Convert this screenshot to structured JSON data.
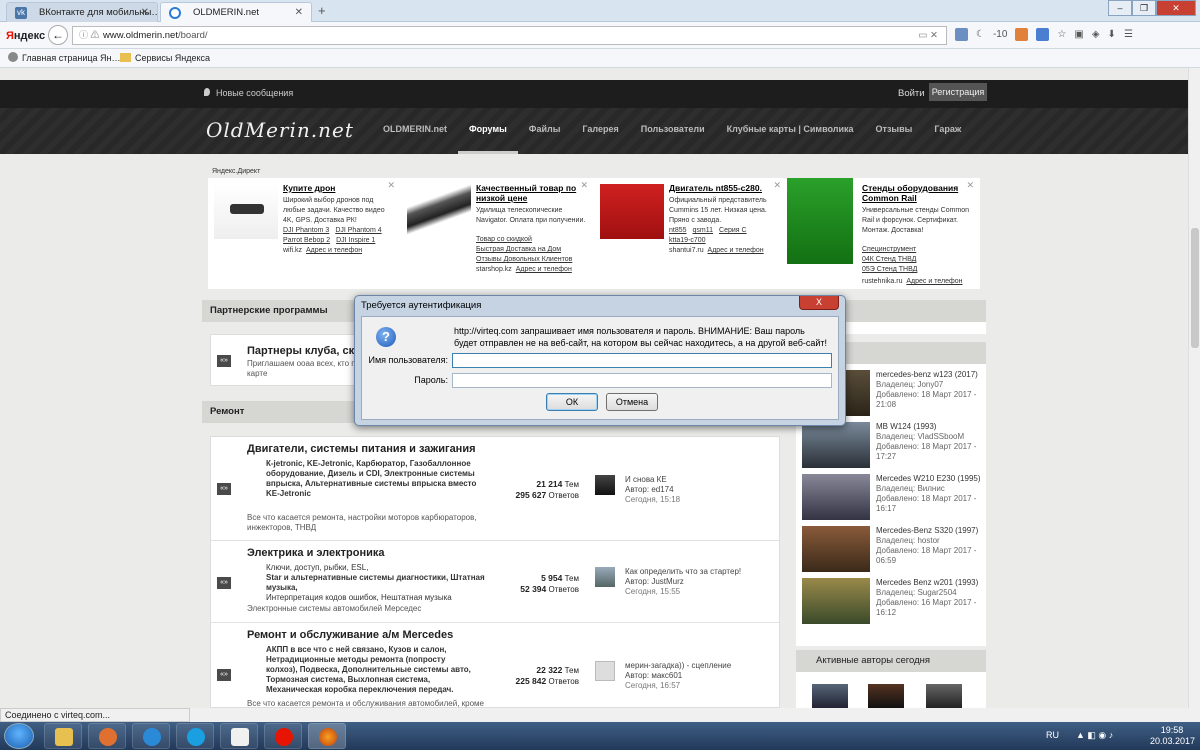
{
  "browser": {
    "tabs": [
      {
        "title": "ВКонтакте для мобильны…",
        "favicon": "vk-icon"
      },
      {
        "title": "OLDMERIN.net",
        "favicon": "firefox-globe-icon"
      }
    ],
    "logo": {
      "prefix": "Я",
      "rest": "ндекс"
    },
    "url": {
      "scheme_host": "www.oldmerin.net",
      "path": "/board/"
    },
    "zoom_badge": "-10",
    "bookmarks": [
      "Главная страница Ян…",
      "Сервисы Яндекса"
    ],
    "status": "Соединено с virteq.com..."
  },
  "site": {
    "new_messages": "Новые сообщения",
    "login": "Войти",
    "register": "Регистрация",
    "logo": "OldMerin.net",
    "nav": [
      "OLDMERIN.net",
      "Форумы",
      "Файлы",
      "Галерея",
      "Пользователи",
      "Клубные карты | Символика",
      "Отзывы",
      "Гараж"
    ],
    "active_nav": "Форумы"
  },
  "ads": {
    "label": "Яндекс.Директ",
    "items": [
      {
        "title": "Купите дрон",
        "desc": "Широкий выбор дронов под любые задачи. Качество видео 4K, GPS. Доставка РК!",
        "links": [
          [
            "DJI Phantom 3",
            "DJI Phantom 4"
          ],
          [
            "Parrot Bebop 2",
            "DJI Inspire 1"
          ]
        ],
        "domain": "wifi.kz",
        "contact": "Адрес и телефон"
      },
      {
        "title": "Качественный товар по низкой цене",
        "desc": "Удилища телескопические Navigator. Оплата при получении.",
        "links": [
          [
            "Товар со скидкой"
          ],
          [
            "Быстрая Доставка на Дом"
          ],
          [
            "Отзывы Довольных Клиентов"
          ]
        ],
        "domain": "starshop.kz",
        "contact": "Адрес и телефон"
      },
      {
        "title": "Двигатель nt855-c280.",
        "desc": "Официальный представитель Cummins 15 лет. Низкая цена. Пряно с завода.",
        "links": [
          [
            "nt855",
            "qsm11",
            "Серия С"
          ],
          [
            "ktta19-c700"
          ]
        ],
        "domain": "shantui7.ru",
        "contact": "Адрес и телефон"
      },
      {
        "title": "Стенды оборудования Common Rail",
        "desc": "Универсальные стенды Common Rail и форсунок. Сертификат. Монтаж. Доставка!",
        "links": [
          [
            "Специнструмент"
          ],
          [
            "04К Стенд ТНВД"
          ],
          [
            "05Э Стенд ТНВД"
          ]
        ],
        "domain": "rustehnika.ru",
        "contact": "Адрес и телефон"
      }
    ]
  },
  "sections": {
    "partner": "Партнерские программы",
    "repair": "Ремонт"
  },
  "partner_forum": {
    "title": "Партнеры клуба, ск…",
    "desc": "Приглашаем ооаа всех, кто п… клубной карте"
  },
  "forums": [
    {
      "title": "Двигатели, системы питания и зажигания",
      "subs": "К-jetronic,   KE-Jetronic,   Карбюратор, Газобаллонное оборудование,   Дизель и CDI, Электронные системы впрыска, Альтернативные системы впрыска вместо KE-Jetronic",
      "desc": "Все что касается ремонта, настройки моторов карбюраторов, инжекторов, ТНВД",
      "topics": "21 214",
      "topics_label": "Тем",
      "posts": "295 627",
      "posts_label": "Ответов",
      "last_title": "И снова КЕ",
      "last_author": "Автор: ed174",
      "last_time": "Сегодня, 15:18"
    },
    {
      "title": "Электрика и электроника",
      "subs_normal": "Ключи, доступ, рыбки, ESL,",
      "subs": "Star и альтернативные системы диагностики, Штатная музыка,",
      "subs_tail": "Интерпретация кодов ошибок, Нештатная музыка",
      "desc": "Электронные системы автомобилей Мерседес",
      "topics": "5 954",
      "topics_label": "Тем",
      "posts": "52 394",
      "posts_label": "Ответов",
      "last_title": "Как определить что за стартер!",
      "last_author": "Автор: JustMurz",
      "last_time": "Сегодня, 15:55"
    },
    {
      "title": "Ремонт и обслуживание а/м Mercedes",
      "subs": "АКПП в все что с ней связано,   Кузов и салон, Нетрадиционные методы ремонта (попросту колхоз), Подвеска,   Дополнительные системы авто, Тормозная система,   Выхлопная система, Механическая коробка переключения передач.",
      "desc": "Все что касается ремонта и обслуживания автомобилей, кроме",
      "topics": "22 322",
      "topics_label": "Тем",
      "posts": "225 842",
      "posts_label": "Ответов",
      "last_title": "мерин-загадка)) - сцепление",
      "last_author": "Автор: макс601",
      "last_time": "Сегодня, 16:57"
    }
  ],
  "latest_cars": [
    {
      "title": "mercedes-benz w123 (2017)",
      "owner": "Владелец: Jony07",
      "added": "Добавлено: 18 Март 2017 - 21:08"
    },
    {
      "title": "MB W124 (1993)",
      "owner": "Владелец: VladSSbooM",
      "added": "Добавлено: 18 Март 2017 - 17:27"
    },
    {
      "title": "Mercedes W210 E230 (1995)",
      "owner": "Владелец: Вилнис",
      "added": "Добавлено: 18 Март 2017 - 16:17"
    },
    {
      "title": "Mercedes-Benz S320 (1997)",
      "owner": "Владелец: hostor",
      "added": "Добавлено: 18 Март 2017 - 06:59"
    },
    {
      "title": "Mercedes Benz w201 (1993)",
      "owner": "Владелец: Sugar2504",
      "added": "Добавлено: 16 Март 2017 - 16:12"
    }
  ],
  "active_authors_title": "Активные авторы сегодня",
  "dialog": {
    "title": "Требуется аутентификация",
    "close": "X",
    "message": "http://virteq.com запрашивает имя пользователя и пароль. ВНИМАНИЕ: Ваш пароль будет отправлен не на веб-сайт, на котором вы сейчас находитесь, а на другой веб-сайт!",
    "username_label": "Имя пользователя:",
    "password_label": "Пароль:",
    "username_value": "",
    "password_value": "",
    "ok": "ОК",
    "cancel": "Отмена"
  },
  "taskbar": {
    "lang": "RU",
    "time": "19:58",
    "date": "20.03.2017"
  },
  "colors": {
    "site_dark": "#1d1d1d",
    "section_header": "#d6d6d3",
    "dialog_frame": "#c5d3e3",
    "close_red": "#c84031"
  }
}
